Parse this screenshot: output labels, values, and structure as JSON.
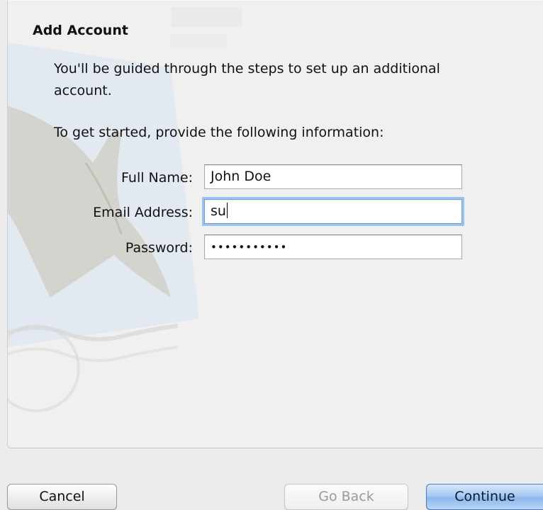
{
  "dialog": {
    "title": "Add Account",
    "intro": "You'll be guided through the steps to set up an additional account.",
    "prompt": "To get started, provide the following information:"
  },
  "form": {
    "full_name": {
      "label": "Full Name:",
      "value": "John Doe"
    },
    "email": {
      "label": "Email Address:",
      "value": "su"
    },
    "password": {
      "label": "Password:",
      "value": "•••••••••••"
    }
  },
  "buttons": {
    "cancel": "Cancel",
    "go_back": "Go Back",
    "continue": "Continue"
  },
  "colors": {
    "focus_ring": "#9cc3ec",
    "default_button": "#8db7ec",
    "background": "#ececec"
  }
}
